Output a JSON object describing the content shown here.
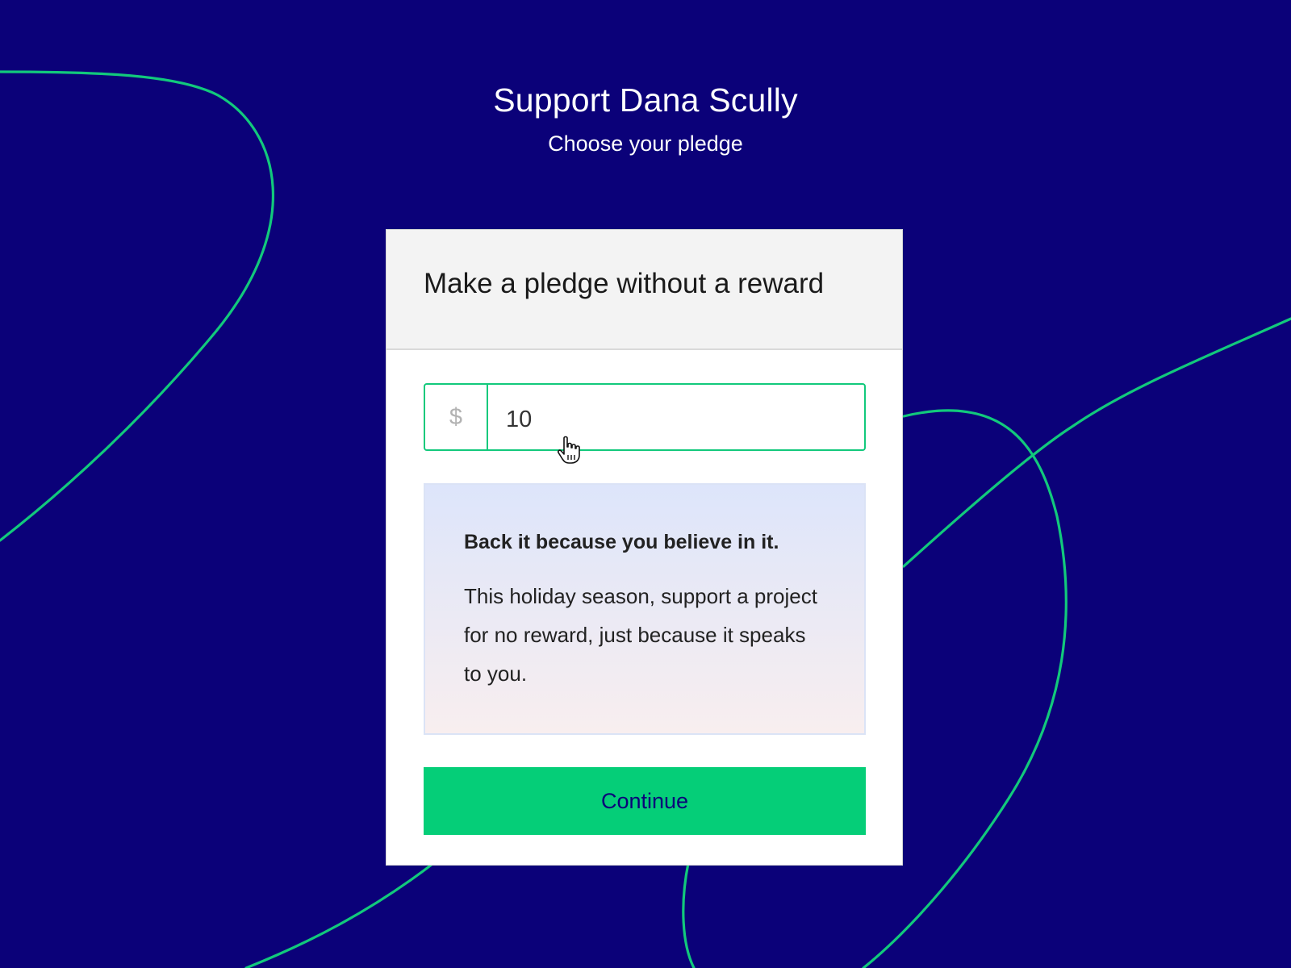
{
  "page": {
    "title": "Support Dana Scully",
    "subtitle": "Choose your pledge"
  },
  "card": {
    "title": "Make a pledge without a reward",
    "amount": {
      "currency_symbol": "$",
      "value": "10"
    },
    "callout": {
      "title": "Back it because you believe in it.",
      "body": "This holiday season, support a project for no reward, just because it speaks to you."
    },
    "continue_label": "Continue"
  },
  "colors": {
    "background": "#0b0179",
    "accent": "#05ce78",
    "line": "#12c97c"
  },
  "icons": {
    "cursor": "hand-pointer-icon"
  }
}
